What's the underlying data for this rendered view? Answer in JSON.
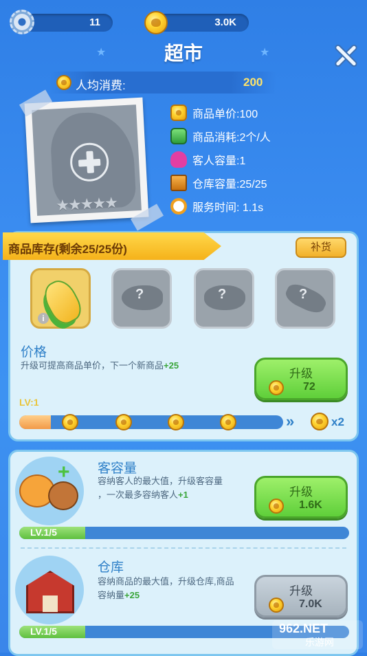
{
  "top_bar": {
    "level_value": "11",
    "coins_value": "3.0K"
  },
  "title": "超市",
  "avg_spend": {
    "label": "人均消费:",
    "value": "200"
  },
  "stats": [
    {
      "icon": "coin-icon",
      "text": "商品单价:100"
    },
    {
      "icon": "basket-icon",
      "text": "商品消耗:2个/人"
    },
    {
      "icon": "customer-icon",
      "text": "客人容量:1"
    },
    {
      "icon": "crate-icon",
      "text": "仓库容量:25/25"
    },
    {
      "icon": "stopwatch-icon",
      "text": "服务时间: 1.1s"
    }
  ],
  "inventory": {
    "title": "商品库存(剩余25/25份)",
    "restock_label": "补货",
    "items": [
      {
        "icon": "corn-icon",
        "locked": false
      },
      {
        "icon": "fish-icon",
        "locked": true,
        "mark": "?"
      },
      {
        "icon": "mushroom-icon",
        "locked": true,
        "mark": "?"
      },
      {
        "icon": "sausage-icon",
        "locked": true,
        "mark": "?"
      }
    ],
    "info_mark": "i"
  },
  "price": {
    "title": "价格",
    "desc": "升级可提高商品单价，下一个新商品",
    "desc_bonus": "+25",
    "button_label": "升级",
    "button_cost": "72",
    "level": "LV:1",
    "progress": 0.12,
    "multiplier": "x2"
  },
  "capacity": {
    "title": "客容量",
    "desc_line1": "容纳客人的最大值，升级客容量",
    "desc_line2": "，一次最多容纳客人",
    "desc_bonus": "+1",
    "button_label": "升级",
    "button_cost": "1.6K",
    "level": "LV.1/5",
    "progress": 0.2
  },
  "warehouse": {
    "title": "仓库",
    "desc_line1": "容纳商品的最大值，升级仓库,商品",
    "desc_line2": "容纳量",
    "desc_bonus": "+25",
    "button_label": "升级",
    "button_cost": "7.0K",
    "level": "LV.1/5",
    "progress": 0.2
  },
  "watermark": {
    "text1": "962.NET",
    "text2": "乐游网"
  }
}
